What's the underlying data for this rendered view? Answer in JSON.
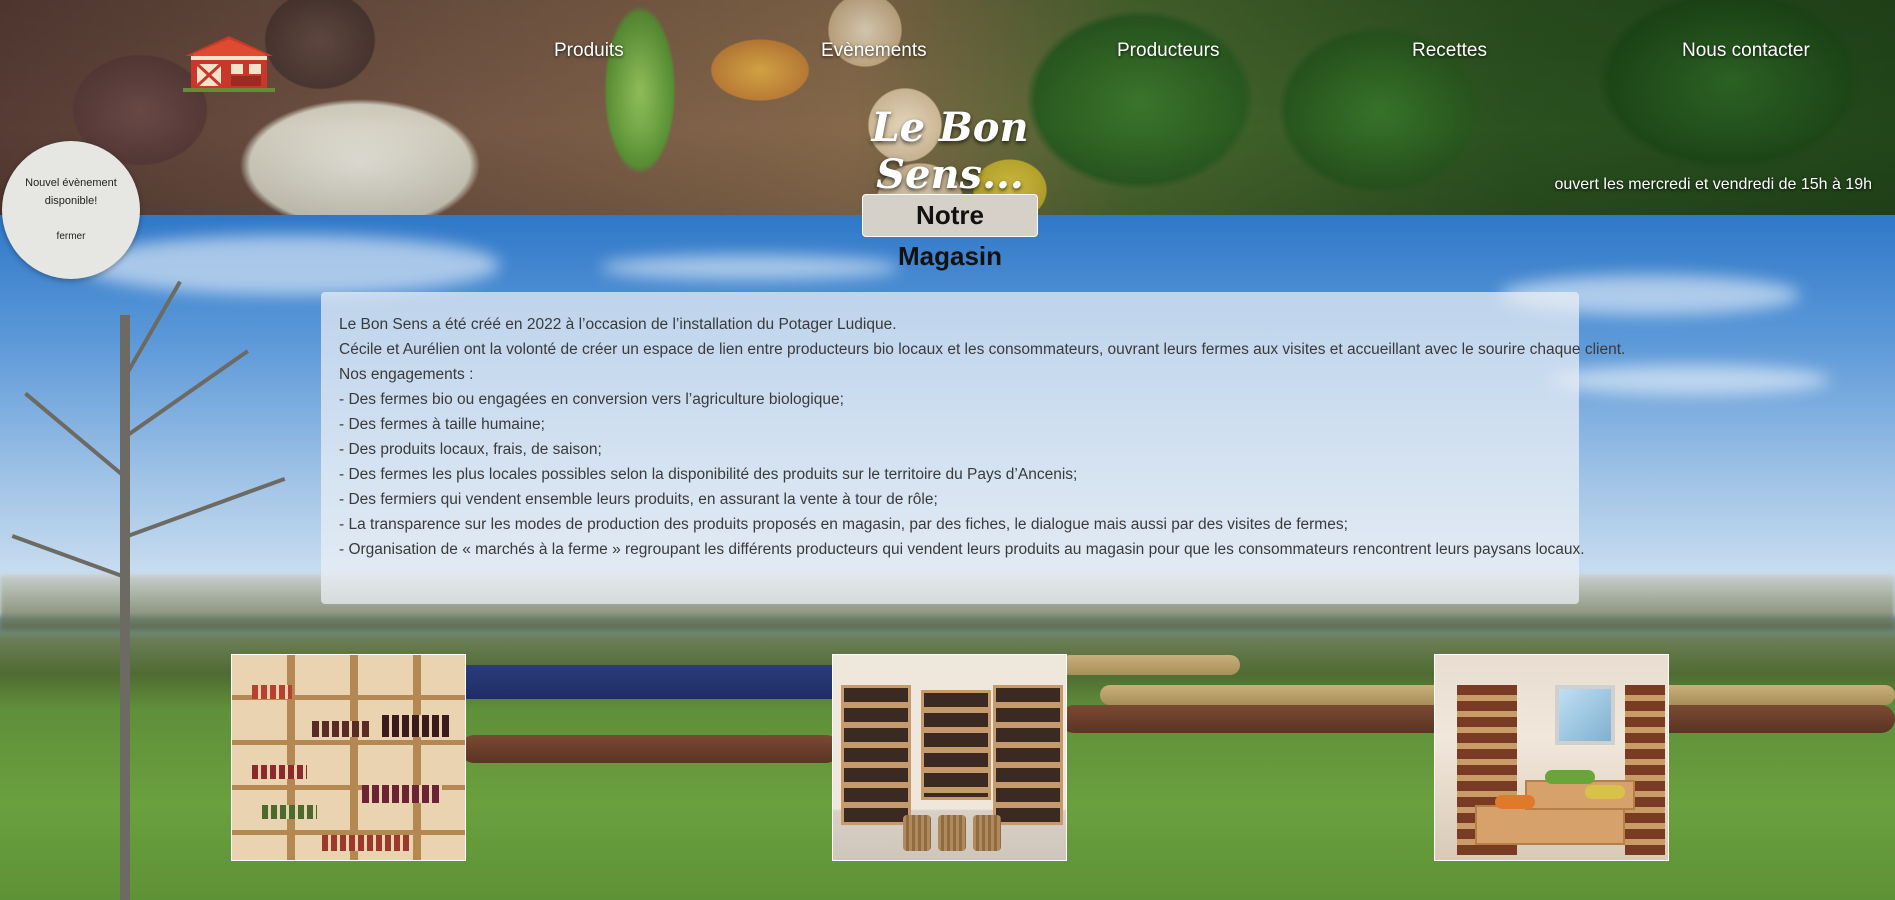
{
  "nav": {
    "items": [
      "Produits",
      "Evènements",
      "Producteurs",
      "Recettes",
      "Nous contacter"
    ]
  },
  "header": {
    "logo_icon": "barn-icon",
    "site_title": "Le Bon Sens...",
    "opening_hours": "ouvert les mercredi et vendredi de 15h à 19h"
  },
  "popup": {
    "message": "Nouvel évènement disponible!",
    "close_label": "fermer"
  },
  "section": {
    "title": "Notre Magasin",
    "paragraphs": [
      "Le Bon Sens a été créé en 2022 à l’occasion de l’installation du Potager Ludique.",
      "Cécile et Aurélien ont la volonté de créer un espace de lien entre producteurs bio locaux et les consommateurs, ouvrant leurs fermes aux visites et accueillant avec le sourire chaque client.",
      "Nos engagements :",
      "- Des fermes bio ou engagées en conversion vers l’agriculture biologique;",
      "- Des fermes à taille humaine;",
      "- Des produits locaux, frais, de saison;",
      "- Des fermes les plus locales possibles selon la disponibilité des produits sur le territoire du Pays d’Ancenis;",
      "- Des fermiers qui vendent ensemble leurs produits, en assurant la vente à tour de rôle;",
      "- La transparence sur les modes de production des produits proposés en magasin, par des fiches, le dialogue mais aussi par des visites de fermes;",
      "- Organisation de « marchés à la ferme » regroupant les différents producteurs qui vendent leurs produits au magasin pour que les consommateurs rencontrent leurs paysans locaux."
    ]
  },
  "colors": {
    "nav_text": "#ffffff",
    "title_box": "#d6d1c8",
    "panel_bg": "#ebf0f5"
  }
}
